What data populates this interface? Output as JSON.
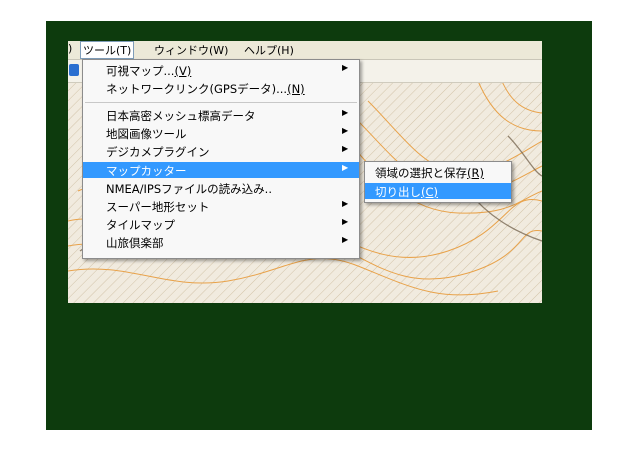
{
  "menubar": {
    "partial_item": ")",
    "items": [
      "ツール(T)",
      "ウィンドウ(W)",
      "ヘルプ(H)"
    ]
  },
  "menu": {
    "items": [
      {
        "label": "可視マップ...",
        "mnemonic": "(V)",
        "submenu": true
      },
      {
        "label": "ネットワークリンク(GPSデータ)...",
        "mnemonic": "(N)",
        "submenu": false
      },
      {
        "label": "日本高密メッシュ標高データ",
        "mnemonic": "",
        "submenu": true
      },
      {
        "label": "地図画像ツール",
        "mnemonic": "",
        "submenu": true
      },
      {
        "label": "デジカメプラグイン",
        "mnemonic": "",
        "submenu": true
      },
      {
        "label": "マップカッター",
        "mnemonic": "",
        "submenu": true,
        "highlighted": true
      },
      {
        "label": "NMEA/IPSファイルの読み込み..",
        "mnemonic": "",
        "submenu": false
      },
      {
        "label": "スーパー地形セット",
        "mnemonic": "",
        "submenu": true
      },
      {
        "label": "タイルマップ",
        "mnemonic": "",
        "submenu": true
      },
      {
        "label": "山旅倶楽部",
        "mnemonic": "",
        "submenu": true
      }
    ]
  },
  "submenu": {
    "items": [
      {
        "label": "領域の選択と保存",
        "mnemonic": "(R)"
      },
      {
        "label": "切り出し",
        "mnemonic": "(C)",
        "highlighted": true
      }
    ]
  },
  "icons": {
    "submenu_arrow": "▶"
  },
  "colors": {
    "outer_background": "#0d3b0d",
    "highlight": "#3399ff",
    "map_contour": "#e8a24a",
    "map_base": "#f1ebdf"
  }
}
